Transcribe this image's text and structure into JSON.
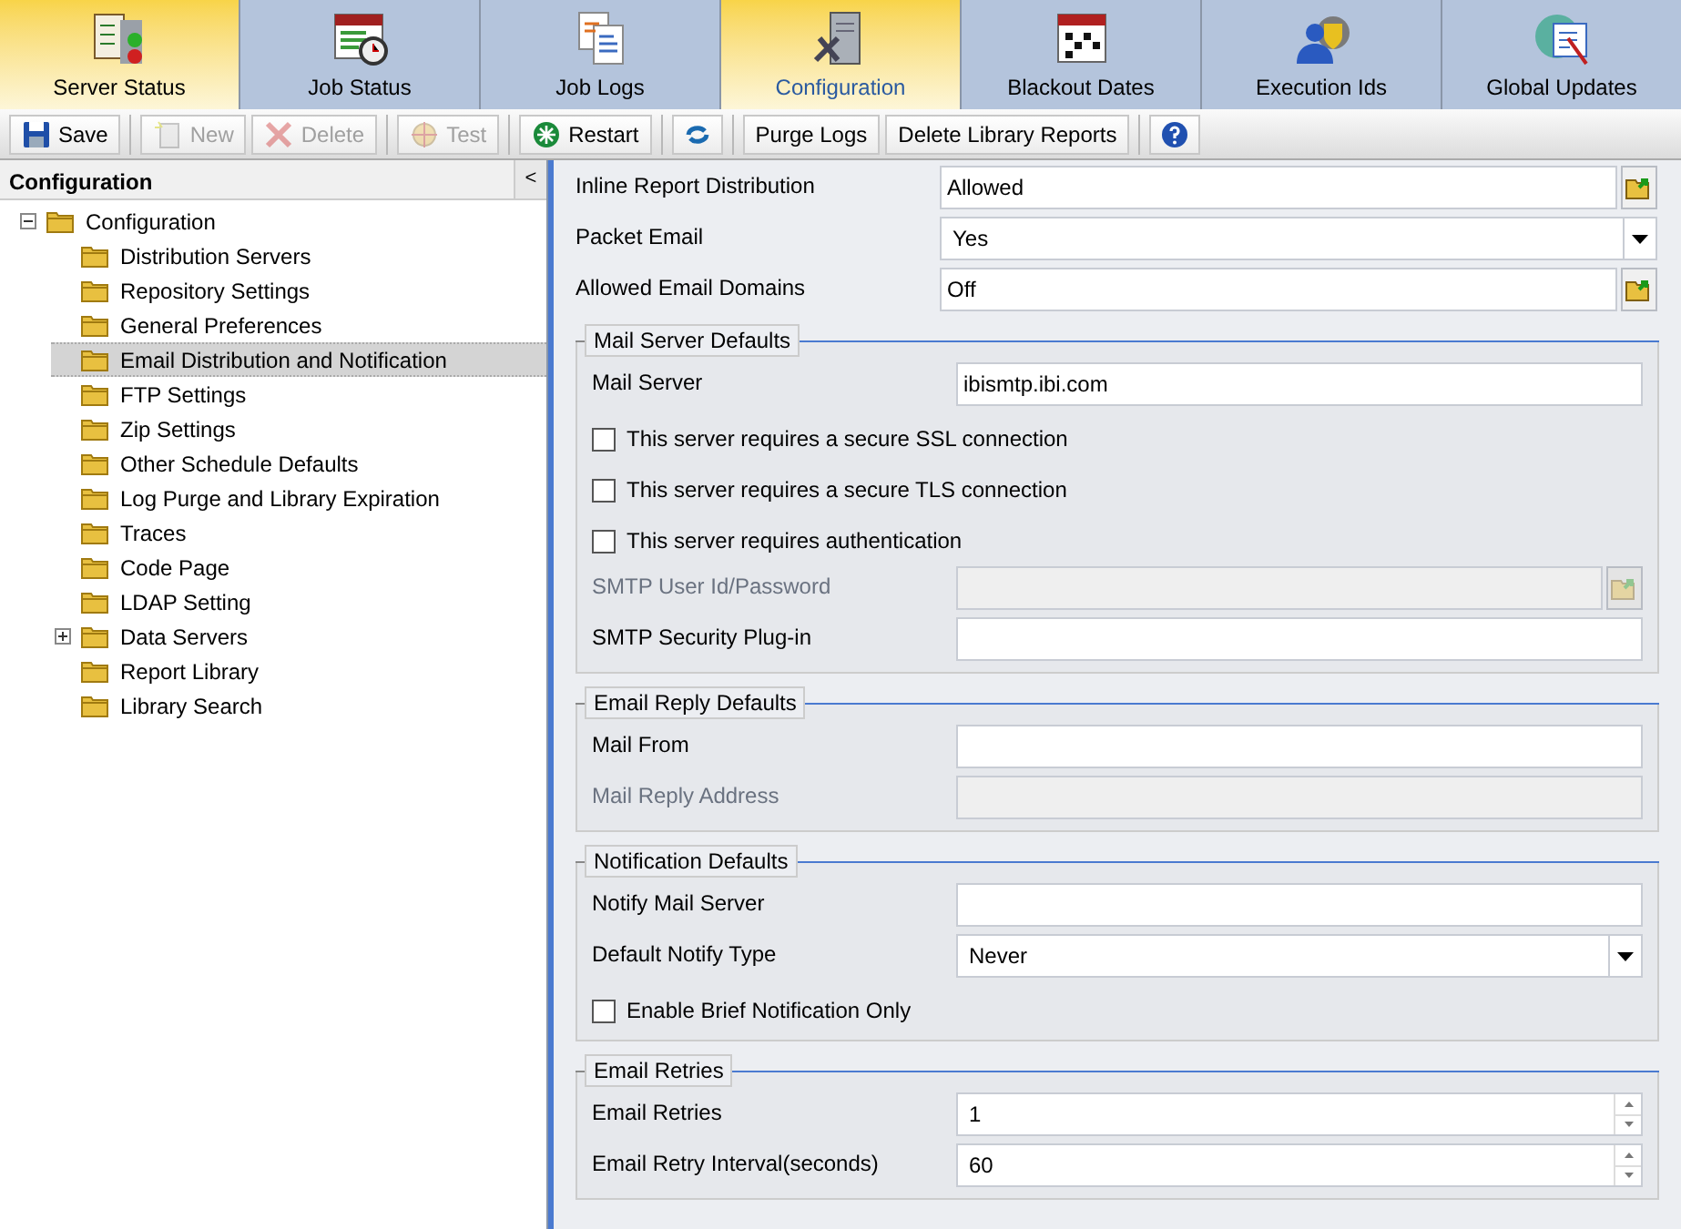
{
  "tabs": [
    {
      "label": "Server Status",
      "selected": false,
      "highlighted": true
    },
    {
      "label": "Job Status",
      "selected": false,
      "highlighted": false
    },
    {
      "label": "Job Logs",
      "selected": false,
      "highlighted": false
    },
    {
      "label": "Configuration",
      "selected": true,
      "highlighted": true
    },
    {
      "label": "Blackout Dates",
      "selected": false,
      "highlighted": false
    },
    {
      "label": "Execution Ids",
      "selected": false,
      "highlighted": false
    },
    {
      "label": "Global Updates",
      "selected": false,
      "highlighted": false
    }
  ],
  "toolbar": [
    {
      "kind": "button",
      "label": "Save",
      "disabled": false
    },
    {
      "kind": "button",
      "label": "New",
      "disabled": true
    },
    {
      "kind": "button",
      "label": "Delete",
      "disabled": true
    },
    {
      "kind": "button",
      "label": "Test",
      "disabled": true
    },
    {
      "kind": "button",
      "label": "Restart",
      "disabled": false
    },
    {
      "kind": "icon"
    },
    {
      "kind": "button",
      "label": "Purge Logs",
      "disabled": false
    },
    {
      "kind": "button",
      "label": "Delete Library Reports",
      "disabled": false
    },
    {
      "kind": "icon"
    }
  ],
  "sidebar": {
    "title": "Configuration",
    "collapse_button": "<",
    "tree": [
      {
        "label": "Configuration",
        "selected": false,
        "expanded": true,
        "children": [
          {
            "label": "Distribution Servers",
            "selected": false
          },
          {
            "label": "Repository Settings",
            "selected": false
          },
          {
            "label": "General Preferences",
            "selected": false
          },
          {
            "label": "Email Distribution and Notification",
            "selected": true
          },
          {
            "label": "FTP Settings",
            "selected": false
          },
          {
            "label": "Zip Settings",
            "selected": false
          },
          {
            "label": "Other Schedule Defaults",
            "selected": false
          },
          {
            "label": "Log Purge and Library Expiration",
            "selected": false
          },
          {
            "label": "Traces",
            "selected": false
          },
          {
            "label": "Code Page",
            "selected": false
          },
          {
            "label": "LDAP Setting",
            "selected": false
          },
          {
            "label": "Data Servers",
            "selected": false,
            "expanded": false
          },
          {
            "label": "Report Library",
            "selected": false
          },
          {
            "label": "Library Search",
            "selected": false
          }
        ]
      }
    ]
  },
  "form": {
    "fields": [
      {
        "kind": "picker",
        "label": "Inline Report Distribution",
        "value": "Allowed",
        "disabled": false
      },
      {
        "kind": "select",
        "label": "Packet Email",
        "value": "Yes",
        "disabled": false
      },
      {
        "kind": "picker",
        "label": "Allowed Email Domains",
        "value": "Off",
        "disabled": false
      }
    ],
    "sections": [
      {
        "title": "Mail Server Defaults",
        "fields": [
          {
            "kind": "text",
            "label": "Mail Server",
            "value": "ibismtp.ibi.com",
            "disabled": false
          },
          {
            "kind": "checkbox",
            "label": "This server requires a secure SSL connection",
            "checked": false
          },
          {
            "kind": "checkbox",
            "label": "This server requires a secure TLS connection",
            "checked": false
          },
          {
            "kind": "checkbox",
            "label": "This server requires authentication",
            "checked": false
          },
          {
            "kind": "picker",
            "label": "SMTP User Id/Password",
            "disabled": true
          },
          {
            "kind": "text",
            "label": "SMTP Security Plug-in",
            "disabled": false
          }
        ]
      },
      {
        "title": "Email Reply Defaults",
        "fields": [
          {
            "kind": "text",
            "label": "Mail From",
            "disabled": false
          },
          {
            "kind": "text",
            "label": "Mail Reply Address",
            "disabled": true
          }
        ]
      },
      {
        "title": "Notification Defaults",
        "fields": [
          {
            "kind": "text",
            "label": "Notify Mail Server",
            "disabled": false
          },
          {
            "kind": "select",
            "label": "Default Notify Type",
            "value": "Never",
            "disabled": false
          },
          {
            "kind": "checkbox",
            "label": "Enable Brief Notification Only",
            "checked": false
          }
        ]
      },
      {
        "title": "Email Retries",
        "fields": [
          {
            "kind": "spinner",
            "label": "Email Retries",
            "value": "1",
            "disabled": false
          },
          {
            "kind": "spinner",
            "label": "Email Retry Interval(seconds)",
            "value": "60",
            "disabled": false
          }
        ]
      }
    ]
  }
}
